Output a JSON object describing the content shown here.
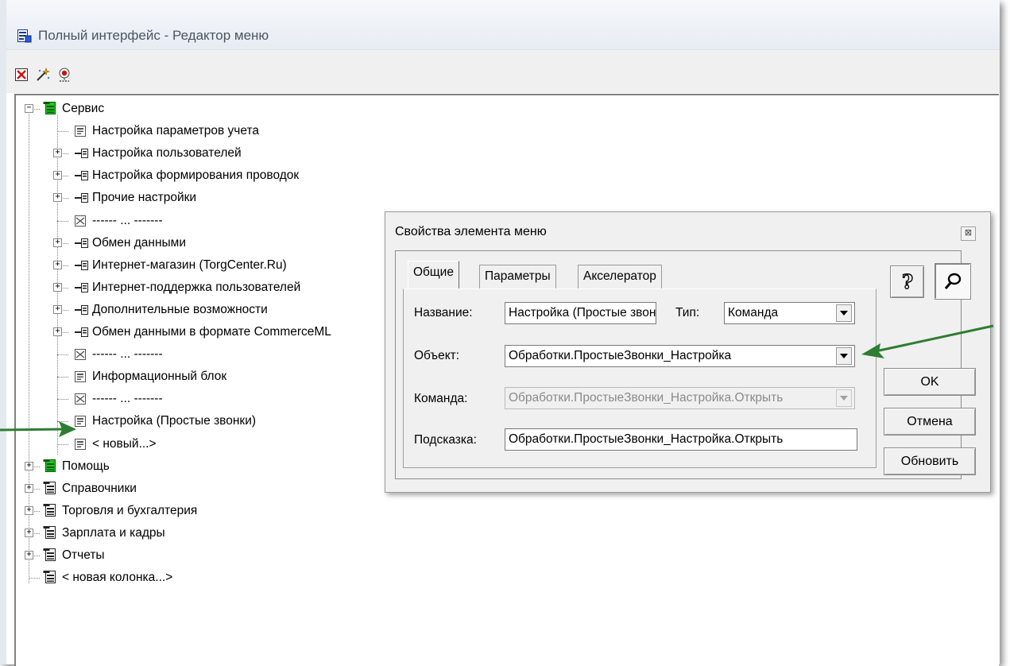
{
  "window": {
    "title": "Полный интерфейс - Редактор меню"
  },
  "toolbar": {
    "buttons": [
      "close-red-icon",
      "magic-wand-icon",
      "debug-icon"
    ]
  },
  "tree": {
    "nodes": [
      {
        "label": "Сервис",
        "icon": "green-column-icon",
        "expander": "−"
      },
      {
        "label": "Настройка параметров учета",
        "icon": "command-icon"
      },
      {
        "label": "Настройка пользователей",
        "icon": "submenu-icon",
        "expander": "+"
      },
      {
        "label": "Настройка формирования проводок",
        "icon": "submenu-icon",
        "expander": "+"
      },
      {
        "label": "Прочие настройки",
        "icon": "submenu-icon",
        "expander": "+"
      },
      {
        "label": "------ ... -------",
        "icon": "separator-icon"
      },
      {
        "label": "Обмен данными",
        "icon": "submenu-icon",
        "expander": "+"
      },
      {
        "label": "Интернет-магазин (TorgCenter.Ru)",
        "icon": "submenu-icon",
        "expander": "+"
      },
      {
        "label": "Интернет-поддержка пользователей",
        "icon": "submenu-icon",
        "expander": "+"
      },
      {
        "label": "Дополнительные возможности",
        "icon": "submenu-icon",
        "expander": "+"
      },
      {
        "label": "Обмен данными в формате CommerceML",
        "icon": "submenu-icon",
        "expander": "+"
      },
      {
        "label": "------ ... -------",
        "icon": "separator-icon"
      },
      {
        "label": "Информационный блок",
        "icon": "command-icon"
      },
      {
        "label": "------ ... -------",
        "icon": "separator-icon"
      },
      {
        "label": "Настройка (Простые звонки)",
        "icon": "command-icon"
      },
      {
        "label": "< новый...>",
        "icon": "command-icon"
      },
      {
        "label": "Помощь",
        "icon": "green-column-icon",
        "expander": "+"
      },
      {
        "label": "Справочники",
        "icon": "column-icon",
        "expander": "+"
      },
      {
        "label": "Торговля и бухгалтерия",
        "icon": "column-icon",
        "expander": "+"
      },
      {
        "label": "Зарплата и кадры",
        "icon": "column-icon",
        "expander": "+"
      },
      {
        "label": "Отчеты",
        "icon": "column-icon",
        "expander": "+"
      },
      {
        "label": "< новая колонка...>",
        "icon": "column-icon"
      }
    ]
  },
  "dialog": {
    "title": "Свойства элемента меню",
    "close": "⊠",
    "tabs": [
      "Общие",
      "Параметры",
      "Акселератор"
    ],
    "fields": {
      "name_label": "Название:",
      "name_value": "Настройка (Простые звонки)",
      "type_label": "Тип:",
      "type_value": "Команда",
      "object_label": "Объект:",
      "object_value": "Обработки.ПростыеЗвонки_Настройка",
      "command_label": "Команда:",
      "command_value": "Обработки.ПростыеЗвонки_Настройка.Открыть",
      "hint_label": "Подсказка:",
      "hint_value": "Обработки.ПростыеЗвонки_Настройка.Открыть"
    },
    "buttons": {
      "ok": "OK",
      "cancel": "Отмена",
      "refresh": "Обновить"
    },
    "colors": {
      "annotation_arrow": "#2e7d32"
    }
  }
}
